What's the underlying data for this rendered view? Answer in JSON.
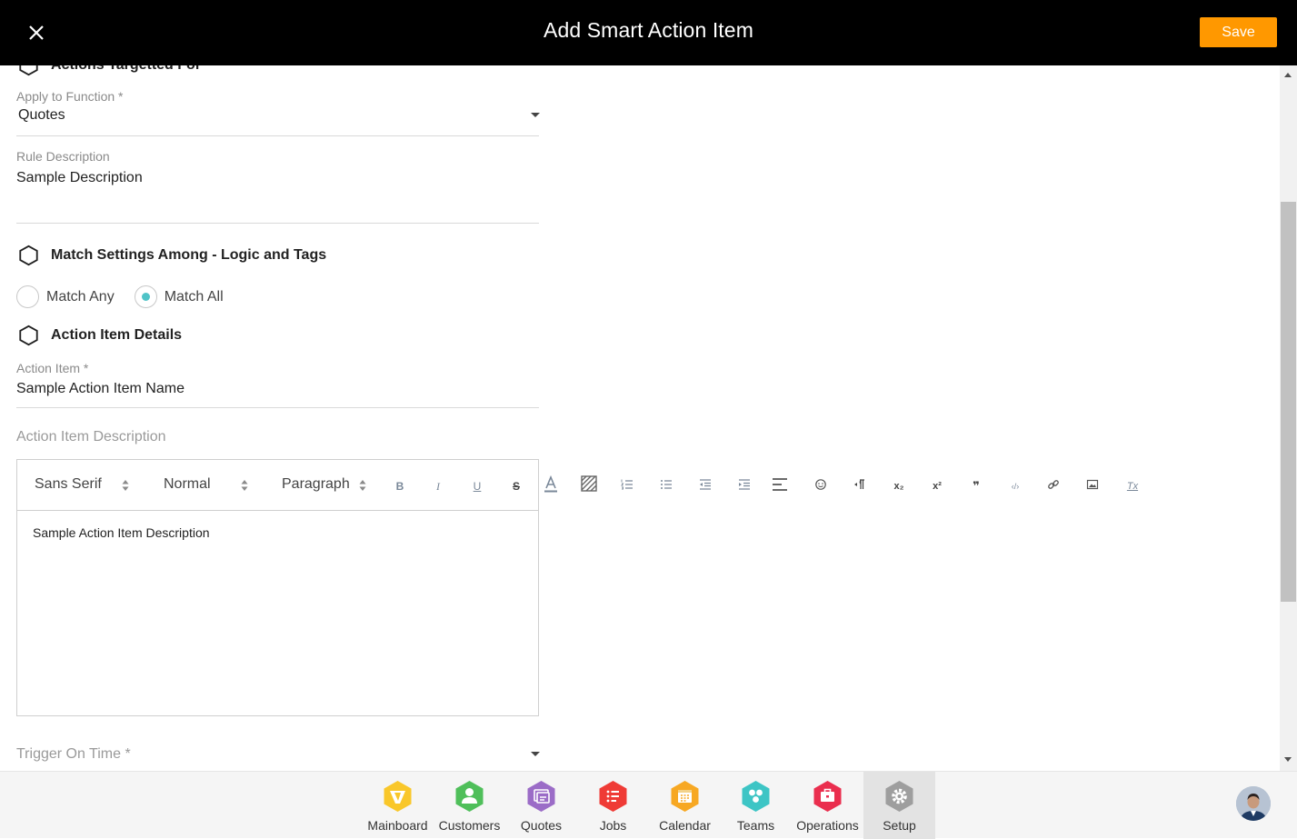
{
  "header": {
    "title": "Add Smart Action Item",
    "save_label": "Save",
    "close_icon": "close-icon"
  },
  "form": {
    "partial_section_title": "Actions Targetted For",
    "apply_function": {
      "label": "Apply to Function *",
      "value": "Quotes"
    },
    "rule_description": {
      "label": "Rule Description",
      "value": "Sample Description"
    },
    "match_section_title": "Match Settings Among - Logic and Tags",
    "match_options": [
      {
        "label": "Match Any",
        "checked": false
      },
      {
        "label": "Match All",
        "checked": true
      }
    ],
    "action_details_title": "Action Item Details",
    "action_item": {
      "label": "Action Item *",
      "value": "Sample Action Item Name"
    },
    "action_description_label": "Action Item Description",
    "editor": {
      "font_select": "Sans Serif",
      "size_select": "Normal",
      "format_select": "Paragraph",
      "content": "Sample Action Item Description",
      "tools": [
        "bold-icon",
        "italic-icon",
        "underline-icon",
        "strike-icon",
        "text-color-icon",
        "background-color-icon",
        "ordered-list-icon",
        "bullet-list-icon",
        "outdent-icon",
        "indent-icon",
        "align-icon",
        "emoji-icon",
        "text-direction-icon",
        "subscript-icon",
        "superscript-icon",
        "blockquote-icon",
        "code-icon",
        "link-icon",
        "image-icon",
        "clear-format-icon"
      ],
      "tool_glyphs": {
        "bold": "B",
        "italic": "I",
        "underline": "U",
        "strike": "S",
        "subscript": "x₂",
        "superscript": "x²",
        "blockquote": "❞",
        "code": "‹/›",
        "clear": "Tx"
      }
    },
    "trigger_on_time": {
      "label": "Trigger On Time *"
    }
  },
  "bottom_nav": {
    "items": [
      {
        "label": "Mainboard",
        "icon": "mainboard-icon",
        "color": "#f9c72a"
      },
      {
        "label": "Customers",
        "icon": "customers-icon",
        "color": "#4fbf5a"
      },
      {
        "label": "Quotes",
        "icon": "quotes-icon",
        "color": "#9b6cc7"
      },
      {
        "label": "Jobs",
        "icon": "jobs-icon",
        "color": "#ef3b36"
      },
      {
        "label": "Calendar",
        "icon": "calendar-icon",
        "color": "#f7a823"
      },
      {
        "label": "Teams",
        "icon": "teams-icon",
        "color": "#3dc5c5"
      },
      {
        "label": "Operations",
        "icon": "operations-icon",
        "color": "#ea2e4e"
      },
      {
        "label": "Setup",
        "icon": "setup-icon",
        "color": "#9e9e9e",
        "active": true
      }
    ]
  },
  "colors": {
    "accent": "#ff9800",
    "radio_checked": "#4fc3c7",
    "header_bg": "#000000"
  }
}
